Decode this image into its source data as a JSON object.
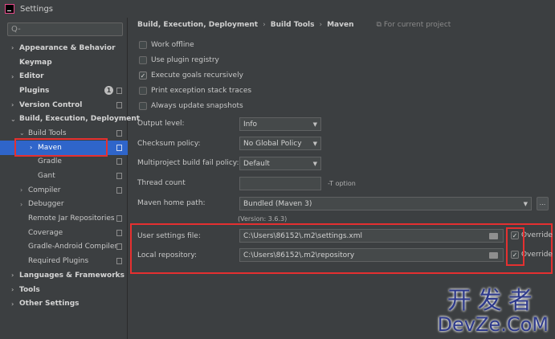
{
  "window": {
    "title": "Settings"
  },
  "search": {
    "placeholder": "Q-"
  },
  "sidebar": {
    "items": [
      {
        "label": "Appearance & Behavior"
      },
      {
        "label": "Keymap"
      },
      {
        "label": "Editor"
      },
      {
        "label": "Plugins",
        "badge": "1"
      },
      {
        "label": "Version Control"
      },
      {
        "label": "Build, Execution, Deployment"
      },
      {
        "label": "Build Tools"
      },
      {
        "label": "Maven"
      },
      {
        "label": "Gradle"
      },
      {
        "label": "Gant"
      },
      {
        "label": "Compiler"
      },
      {
        "label": "Debugger"
      },
      {
        "label": "Remote Jar Repositories"
      },
      {
        "label": "Coverage"
      },
      {
        "label": "Gradle-Android Compiler"
      },
      {
        "label": "Required Plugins"
      },
      {
        "label": "Languages & Frameworks"
      },
      {
        "label": "Tools"
      },
      {
        "label": "Other Settings"
      }
    ]
  },
  "breadcrumb": {
    "items": [
      "Build, Execution, Deployment",
      "Build Tools",
      "Maven"
    ],
    "scope": "For current project"
  },
  "options": {
    "work_offline": {
      "label": "Work offline",
      "checked": false
    },
    "use_plugin_registry": {
      "label": "Use plugin registry",
      "checked": false
    },
    "execute_goals_recursively": {
      "label": "Execute goals recursively",
      "checked": true
    },
    "print_exception": {
      "label": "Print exception stack traces",
      "checked": false
    },
    "always_update_snapshots": {
      "label": "Always update snapshots",
      "checked": false
    }
  },
  "fields": {
    "output_level": {
      "label": "Output level:",
      "value": "Info"
    },
    "checksum_policy": {
      "label": "Checksum policy:",
      "value": "No Global Policy"
    },
    "multiproject_policy": {
      "label": "Multiproject build fail policy:",
      "value": "Default"
    },
    "thread_count": {
      "label": "Thread count",
      "value": "",
      "note": "-T option"
    },
    "maven_home": {
      "label": "Maven home path:",
      "value": "Bundled (Maven 3)",
      "version": "(Version: 3.6.3)",
      "browse": "..."
    },
    "user_settings": {
      "label": "User settings file:",
      "value": "C:\\Users\\86152\\.m2\\settings.xml",
      "override_label": "Override",
      "override_checked": true
    },
    "local_repo": {
      "label": "Local repository:",
      "value": "C:\\Users\\86152\\.m2\\repository",
      "override_label": "Override",
      "override_checked": true
    }
  },
  "watermark": {
    "cn": "开发者",
    "en": "DevZe.CoM"
  },
  "colors": {
    "accent": "#2f65ca",
    "highlight_box": "#e53030",
    "background": "#3c3f41"
  }
}
